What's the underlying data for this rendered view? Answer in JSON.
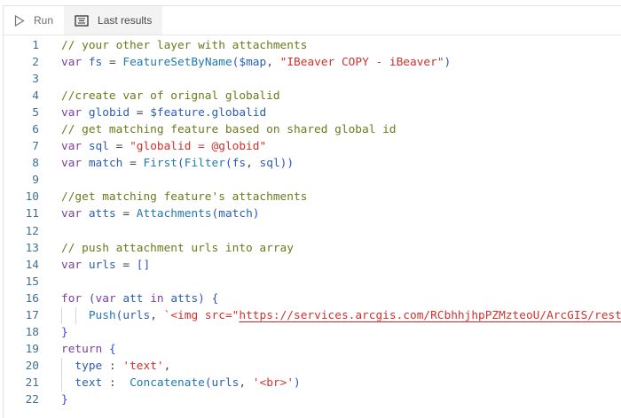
{
  "toolbar": {
    "run_label": "Run",
    "last_results_label": "Last results"
  },
  "colors": {
    "comment": "#6b7a1c",
    "keyword": "#7a3e9d",
    "identifier": "#2a5fb0",
    "string": "#d0312d",
    "function": "#1f78b0"
  },
  "lines": [
    [
      [
        "cm",
        "// your other layer with attachments"
      ]
    ],
    [
      [
        "kw",
        "var "
      ],
      [
        "id",
        "fs"
      ],
      [
        "pu",
        " = "
      ],
      [
        "fn",
        "FeatureSetByName"
      ],
      [
        "br",
        "("
      ],
      [
        "id",
        "$map"
      ],
      [
        "pu",
        ", "
      ],
      [
        "st",
        "\"IBeaver COPY - iBeaver\""
      ],
      [
        "br",
        ")"
      ]
    ],
    [],
    [
      [
        "cm",
        "//create var of orignal globalid"
      ]
    ],
    [
      [
        "kw",
        "var "
      ],
      [
        "id",
        "globid"
      ],
      [
        "pu",
        " = "
      ],
      [
        "id",
        "$feature.globalid"
      ]
    ],
    [
      [
        "cm",
        "// get matching feature based on shared global id"
      ]
    ],
    [
      [
        "kw",
        "var "
      ],
      [
        "id",
        "sql"
      ],
      [
        "pu",
        " = "
      ],
      [
        "st",
        "\"globalid = @globid\""
      ]
    ],
    [
      [
        "kw",
        "var "
      ],
      [
        "id",
        "match"
      ],
      [
        "pu",
        " = "
      ],
      [
        "fn",
        "First"
      ],
      [
        "br",
        "("
      ],
      [
        "fn",
        "Filter"
      ],
      [
        "br",
        "("
      ],
      [
        "id",
        "fs"
      ],
      [
        "pu",
        ", "
      ],
      [
        "id",
        "sql"
      ],
      [
        "br",
        "))"
      ]
    ],
    [],
    [
      [
        "cm",
        "//get matching feature's attachments"
      ]
    ],
    [
      [
        "kw",
        "var "
      ],
      [
        "id",
        "atts"
      ],
      [
        "pu",
        " = "
      ],
      [
        "fn",
        "Attachments"
      ],
      [
        "br",
        "("
      ],
      [
        "id",
        "match"
      ],
      [
        "br",
        ")"
      ]
    ],
    [],
    [
      [
        "cm",
        "// push attachment urls into array"
      ]
    ],
    [
      [
        "kw",
        "var "
      ],
      [
        "id",
        "urls"
      ],
      [
        "pu",
        " = "
      ],
      [
        "br",
        "[]"
      ]
    ],
    [],
    [
      [
        "kw",
        "for "
      ],
      [
        "br",
        "("
      ],
      [
        "kw",
        "var "
      ],
      [
        "id",
        "att"
      ],
      [
        "kw",
        " in "
      ],
      [
        "id",
        "atts"
      ],
      [
        "br",
        ") {"
      ]
    ],
    [
      [
        "pu",
        "    "
      ],
      [
        "fn",
        "Push"
      ],
      [
        "br",
        "("
      ],
      [
        "id",
        "urls"
      ],
      [
        "pu",
        ", "
      ],
      [
        "st",
        "`<img src=\""
      ],
      [
        "st url",
        "https://services.arcgis.com/RCbhhjhpPZMzteoU/ArcGIS/rest"
      ]
    ],
    [
      [
        "br",
        "}"
      ]
    ],
    [
      [
        "kw",
        "return "
      ],
      [
        "br",
        "{"
      ]
    ],
    [
      [
        "pu",
        "  "
      ],
      [
        "id",
        "type"
      ],
      [
        "pu",
        " : "
      ],
      [
        "st",
        "'text'"
      ],
      [
        "pu",
        ","
      ]
    ],
    [
      [
        "pu",
        "  "
      ],
      [
        "id",
        "text"
      ],
      [
        "pu",
        " :  "
      ],
      [
        "fn",
        "Concatenate"
      ],
      [
        "br",
        "("
      ],
      [
        "id",
        "urls"
      ],
      [
        "pu",
        ", "
      ],
      [
        "st",
        "'<br>'"
      ],
      [
        "br",
        ")"
      ]
    ],
    [
      [
        "br",
        "}"
      ]
    ]
  ]
}
